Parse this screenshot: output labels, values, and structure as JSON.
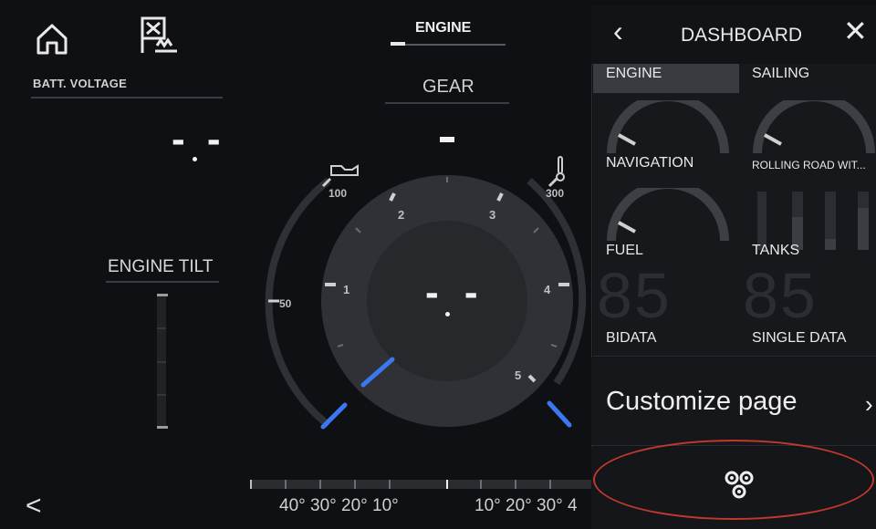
{
  "header": {
    "engine_tab": "ENGINE"
  },
  "left": {
    "batt_voltage_label": "BATT. VOLTAGE",
    "batt_voltage_value": "- -",
    "engine_tilt_label": "ENGINE TILT"
  },
  "center": {
    "gear_label": "GEAR",
    "gear_value": "-",
    "center_value": "- -",
    "oil_scale": [
      "100",
      "50"
    ],
    "temp_scale": [
      "300"
    ],
    "rpm_scale": [
      "1",
      "2",
      "3",
      "4",
      "5"
    ],
    "angle_labels_left": "40° 30° 20° 10°",
    "angle_labels_right": "10° 20° 30° 4"
  },
  "panel": {
    "title": "DASHBOARD",
    "tiles": [
      {
        "label": "ENGINE",
        "selected": true
      },
      {
        "label": "SAILING",
        "selected": false
      },
      {
        "label": "NAVIGATION",
        "selected": false
      },
      {
        "label": "ROLLING ROAD WIT...",
        "selected": false
      },
      {
        "label": "FUEL",
        "selected": false
      },
      {
        "label": "TANKS",
        "selected": false
      },
      {
        "label": "BIDATA",
        "selected": false
      },
      {
        "label": "SINGLE DATA",
        "selected": false
      }
    ],
    "bg_digits_left": "85",
    "bg_digits_right": "85",
    "customize_label": "Customize page"
  },
  "icons": {
    "home": "home-icon",
    "flag": "flag-icon",
    "back": "chevron-left-icon",
    "close": "close-icon",
    "settings": "settings-cogs-icon",
    "oil": "oil-can-icon",
    "temp": "thermometer-icon"
  },
  "colors": {
    "needle": "#3a78f2",
    "highlight_oval": "#c0392b",
    "selected_tile": "#3a3b40"
  }
}
